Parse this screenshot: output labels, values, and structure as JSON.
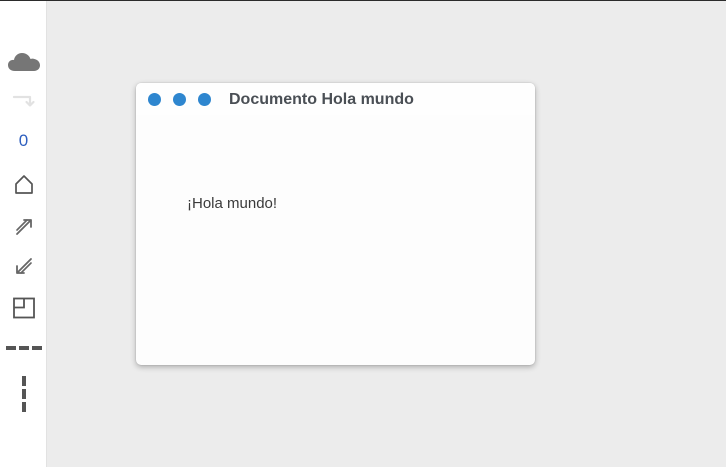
{
  "sidebar": {
    "items": [
      {
        "name": "cloud-icon"
      },
      {
        "name": "redirect-arrow-icon"
      },
      {
        "name": "counter",
        "value": "0"
      },
      {
        "name": "home-icon"
      },
      {
        "name": "expand-arrow-icon"
      },
      {
        "name": "collapse-arrow-icon"
      },
      {
        "name": "layout-panel-icon"
      },
      {
        "name": "horizontal-dashes-icon"
      },
      {
        "name": "vertical-dashes-icon"
      }
    ],
    "counter": "0"
  },
  "window": {
    "title": "Documento Hola mundo",
    "content": "¡Hola mundo!",
    "button_color": "#2e86cf"
  },
  "colors": {
    "background": "#ececec",
    "sidebar": "#ffffff",
    "accent": "#2e86cf",
    "counter": "#2e5fbf"
  }
}
